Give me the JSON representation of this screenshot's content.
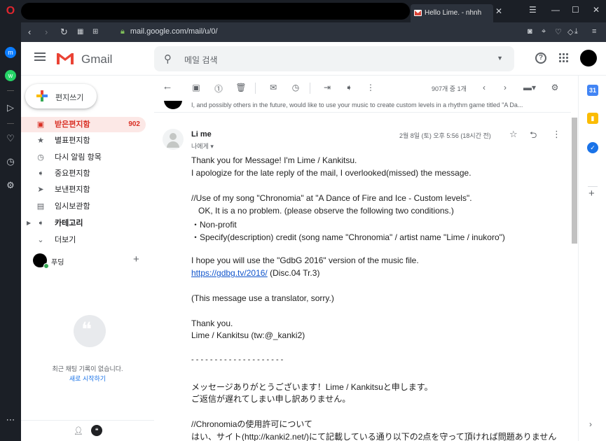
{
  "browser": {
    "tab_title": "Hello Lime. - nhnh",
    "url": "mail.google.com/mail/u/0/"
  },
  "gmail": {
    "logo_text": "Gmail",
    "search_placeholder": "메일 검색"
  },
  "nav": {
    "compose": "편지쓰기",
    "items": [
      {
        "label": "받은편지함",
        "count": "902",
        "icon": "inbox-icon"
      },
      {
        "label": "별표편지함",
        "icon": "star-icon"
      },
      {
        "label": "다시 알림 항목",
        "icon": "clock-icon"
      },
      {
        "label": "중요편지함",
        "icon": "label-important-icon"
      },
      {
        "label": "보낸편지함",
        "icon": "send-icon"
      },
      {
        "label": "임시보관함",
        "icon": "draft-icon"
      },
      {
        "label": "카테고리",
        "icon": "label-icon"
      },
      {
        "label": "더보기",
        "icon": "chevron-down-icon"
      }
    ],
    "hangouts_user": "푸딩",
    "chat_empty_text": "최근 채팅 기록이 없습니다.",
    "chat_start": "새로 시작하기"
  },
  "toolbar": {
    "count_text": "907개 중 1개"
  },
  "thread": {
    "prev_snippet": "I, and possibly others in the future, would like to use your music to create custom levels in a rhythm game titled \"A Da...",
    "sender": "Li me",
    "to": "나에게",
    "date": "2월 8일 (토) 오후 5:56 (18시간 전)",
    "body": [
      "Thank you for Message! I'm Lime / Kankitsu.",
      "I apologize for the late reply of the mail, I overlooked(missed) the message.",
      "//Use of my song \"Chronomia\" at \"A Dance of Fire and Ice - Custom levels\".",
      "   OK, It is a no problem. (please observe the following two conditions.)",
      "・Non-profit",
      "・Specify(description) credit (song name \"Chronomia\" / artist name \"Lime / inukoro\")",
      "I hope you will use the \"GdbG 2016\" version of the music file.",
      "https://gdbg.tv/2016/",
      " (Disc.04 Tr.3)",
      "(This message use a translator, sorry.)",
      "Thank you.",
      "Lime / Kankitsu (tw:@_kanki2)",
      "- - - - - - - - - - - - - - - - - - - -",
      "メッセージありがとうございます！Lime / Kankitsuと申します。",
      "ご返信が遅れてしまい申し訳ありません。",
      "//Chronomiaの使用許可について",
      "はい、サイト(http://kanki2.net/)にて記載している通り以下の2点を守って頂ければ問題ありません"
    ]
  }
}
